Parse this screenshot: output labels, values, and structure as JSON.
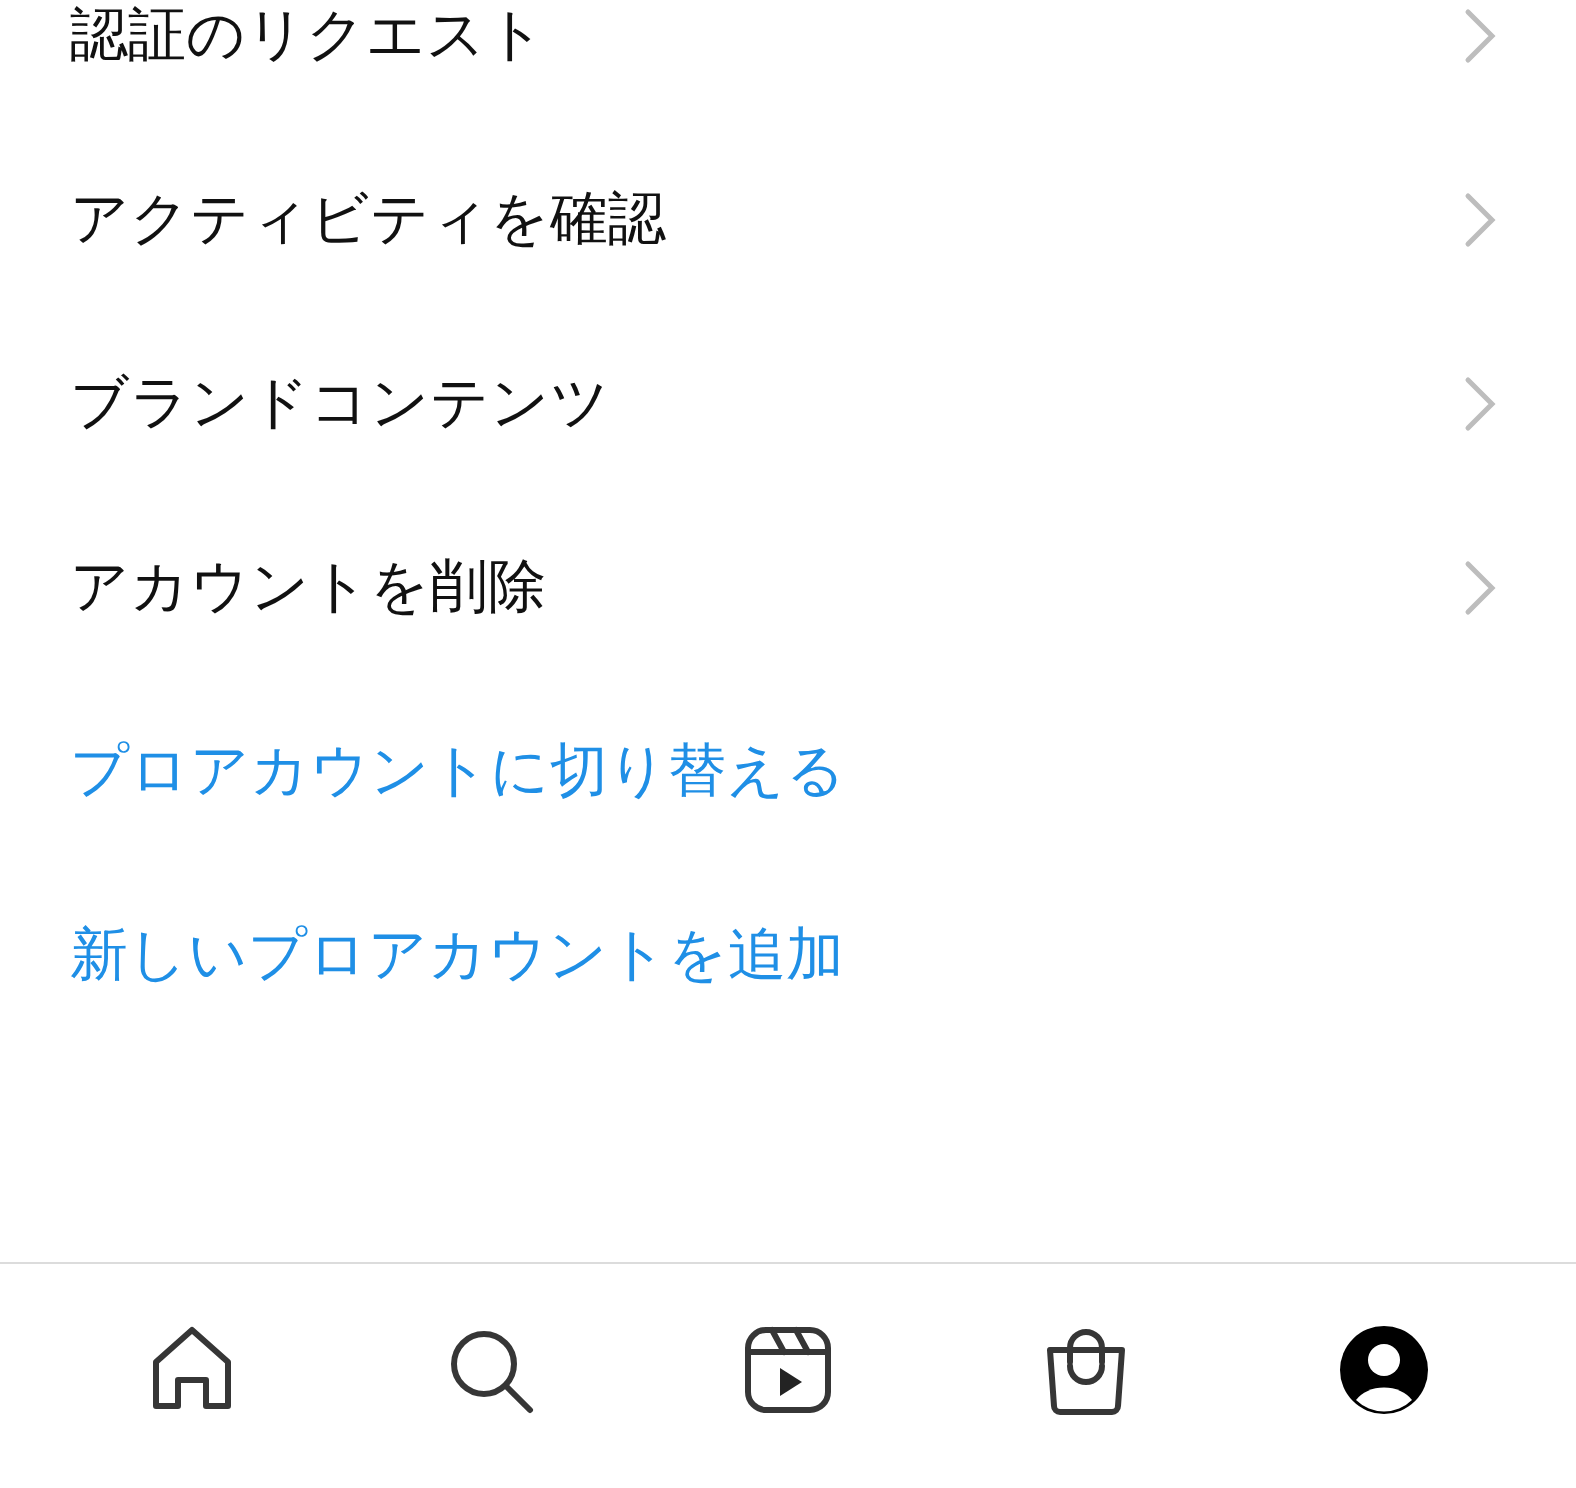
{
  "menu_items": [
    {
      "label": "認証のリクエスト",
      "kind": "nav"
    },
    {
      "label": "アクティビティを確認",
      "kind": "nav"
    },
    {
      "label": "ブランドコンテンツ",
      "kind": "nav"
    },
    {
      "label": "アカウントを削除",
      "kind": "nav"
    },
    {
      "label": "プロアカウントに切り替える",
      "kind": "link"
    },
    {
      "label": "新しいプロアカウントを追加",
      "kind": "link"
    }
  ],
  "tab_bar": [
    {
      "selected": false
    },
    {
      "selected": false
    },
    {
      "selected": false
    },
    {
      "selected": false
    },
    {
      "selected": true
    }
  ]
}
